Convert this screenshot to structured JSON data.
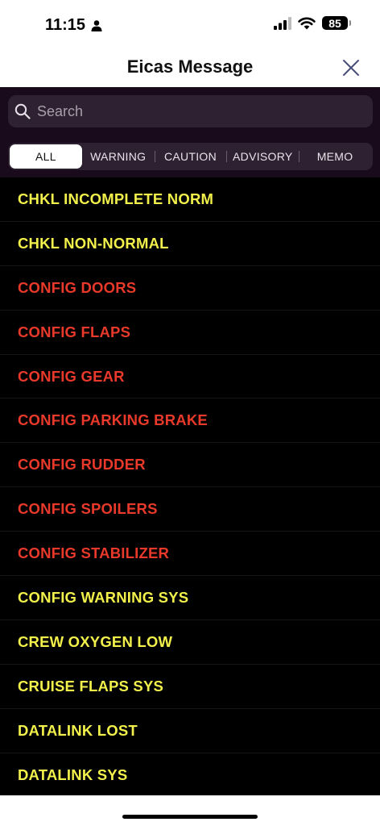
{
  "status_bar": {
    "time": "11:15",
    "battery": "85"
  },
  "header": {
    "title": "Eicas Message"
  },
  "search": {
    "placeholder": "Search"
  },
  "tabs": [
    {
      "label": "ALL",
      "active": true
    },
    {
      "label": "WARNING",
      "active": false
    },
    {
      "label": "CAUTION",
      "active": false
    },
    {
      "label": "ADVISORY",
      "active": false
    },
    {
      "label": "MEMO",
      "active": false
    }
  ],
  "colors": {
    "caution": "#f2f04a",
    "warning": "#e8392a"
  },
  "messages": [
    {
      "label": "CHKL INCOMPLETE NORM",
      "level": "caution"
    },
    {
      "label": "CHKL NON-NORMAL",
      "level": "caution"
    },
    {
      "label": "CONFIG DOORS",
      "level": "warning"
    },
    {
      "label": "CONFIG FLAPS",
      "level": "warning"
    },
    {
      "label": "CONFIG GEAR",
      "level": "warning"
    },
    {
      "label": "CONFIG PARKING BRAKE",
      "level": "warning"
    },
    {
      "label": "CONFIG RUDDER",
      "level": "warning"
    },
    {
      "label": "CONFIG SPOILERS",
      "level": "warning"
    },
    {
      "label": "CONFIG STABILIZER",
      "level": "warning"
    },
    {
      "label": "CONFIG WARNING SYS",
      "level": "caution"
    },
    {
      "label": "CREW OXYGEN LOW",
      "level": "caution"
    },
    {
      "label": "CRUISE FLAPS SYS",
      "level": "caution"
    },
    {
      "label": "DATALINK LOST",
      "level": "caution"
    },
    {
      "label": "DATALINK SYS",
      "level": "caution"
    }
  ]
}
